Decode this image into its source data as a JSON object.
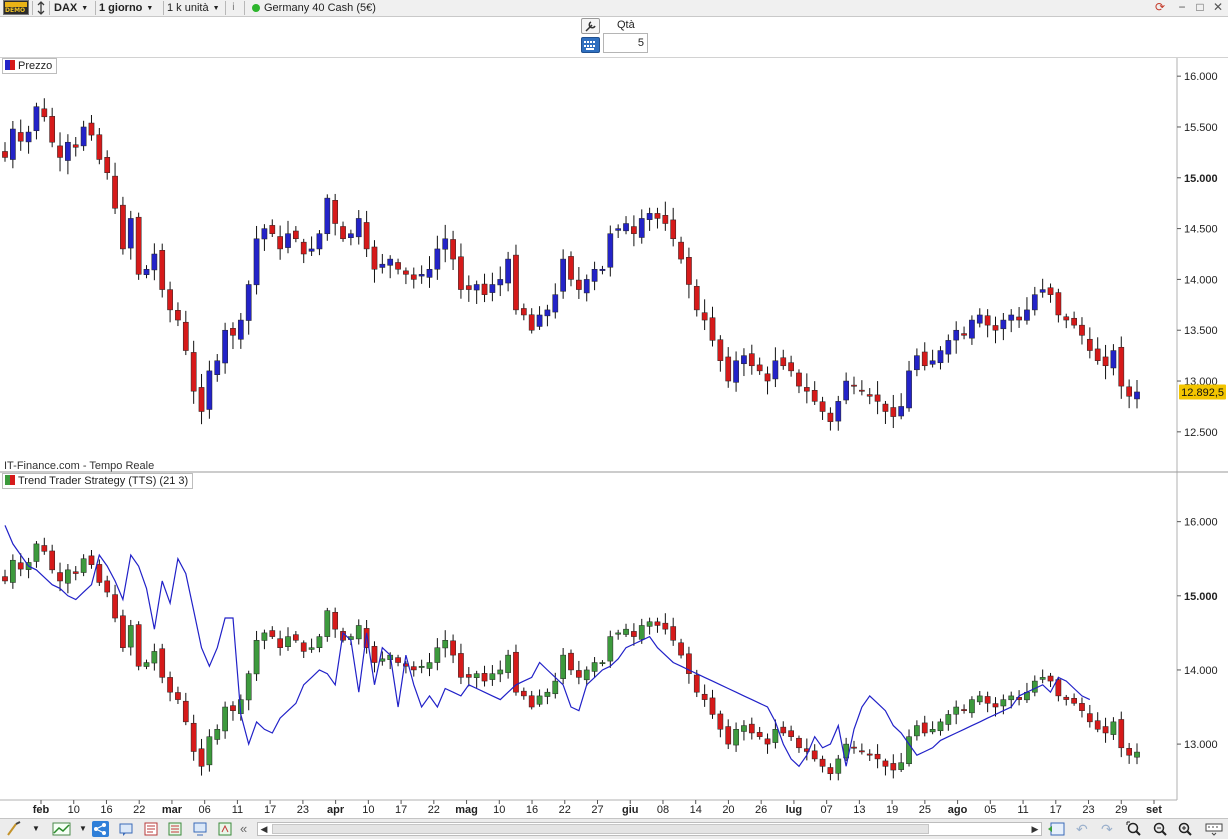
{
  "toolbar": {
    "demo_badge": "DEMO",
    "symbol": "DAX",
    "timeframe": "1 giorno",
    "units": "1 k unità",
    "instrument": "Germany 40 Cash (5€)",
    "status_color": "#2db52d"
  },
  "order_panel": {
    "qty_label": "Qtà",
    "qty_value": "5"
  },
  "price_chart": {
    "label": "Prezzo",
    "watermark": "IT-Finance.com - Tempo Reale",
    "y_ticks": [
      "16.000",
      "15.500",
      "15.000",
      "14.500",
      "14.000",
      "13.500",
      "13.000",
      "12.500"
    ],
    "last_price": "12.892,5",
    "last_price_bg": "#f3c500"
  },
  "indicator_chart": {
    "label": "Trend Trader Strategy (TTS) (21 3)",
    "y_ticks": [
      "16.000",
      "15.000",
      "14.000",
      "13.000"
    ],
    "line_color": "#2121c8"
  },
  "x_axis": {
    "ticks": [
      {
        "label": "feb",
        "bold": true
      },
      {
        "label": "10",
        "bold": false
      },
      {
        "label": "16",
        "bold": false
      },
      {
        "label": "22",
        "bold": false
      },
      {
        "label": "mar",
        "bold": true
      },
      {
        "label": "06",
        "bold": false
      },
      {
        "label": "11",
        "bold": false
      },
      {
        "label": "17",
        "bold": false
      },
      {
        "label": "23",
        "bold": false
      },
      {
        "label": "apr",
        "bold": true
      },
      {
        "label": "10",
        "bold": false
      },
      {
        "label": "17",
        "bold": false
      },
      {
        "label": "22",
        "bold": false
      },
      {
        "label": "mag",
        "bold": true
      },
      {
        "label": "10",
        "bold": false
      },
      {
        "label": "16",
        "bold": false
      },
      {
        "label": "22",
        "bold": false
      },
      {
        "label": "27",
        "bold": false
      },
      {
        "label": "giu",
        "bold": true
      },
      {
        "label": "08",
        "bold": false
      },
      {
        "label": "14",
        "bold": false
      },
      {
        "label": "20",
        "bold": false
      },
      {
        "label": "26",
        "bold": false
      },
      {
        "label": "lug",
        "bold": true
      },
      {
        "label": "07",
        "bold": false
      },
      {
        "label": "13",
        "bold": false
      },
      {
        "label": "19",
        "bold": false
      },
      {
        "label": "25",
        "bold": false
      },
      {
        "label": "ago",
        "bold": true
      },
      {
        "label": "05",
        "bold": false
      },
      {
        "label": "11",
        "bold": false
      },
      {
        "label": "17",
        "bold": false
      },
      {
        "label": "23",
        "bold": false
      },
      {
        "label": "29",
        "bold": false
      },
      {
        "label": "set",
        "bold": true
      }
    ]
  },
  "colors": {
    "bull": "#2323c8",
    "bear": "#d61a1a",
    "tts_bull": "#3d9a3d",
    "tts_bear": "#d61a1a"
  },
  "chart_data": {
    "type": "candlestick",
    "series_close": [
      15200,
      15480,
      15360,
      15450,
      15700,
      15600,
      15350,
      15200,
      15350,
      15300,
      15500,
      15420,
      15180,
      15050,
      14700,
      14300,
      14600,
      14050,
      14100,
      14250,
      13900,
      13700,
      13600,
      13300,
      12900,
      12700,
      13100,
      13200,
      13500,
      13450,
      13600,
      13950,
      14400,
      14500,
      14450,
      14300,
      14450,
      14400,
      14250,
      14300,
      14450,
      14800,
      14550,
      14400,
      14450,
      14600,
      14300,
      14100,
      14150,
      14200,
      14100,
      14050,
      14000,
      14050,
      14100,
      14300,
      14400,
      14200,
      13900,
      13900,
      13950,
      13850,
      13950,
      14000,
      14200,
      13700,
      13650,
      13500,
      13650,
      13700,
      13850,
      14200,
      14000,
      13900,
      14000,
      14100,
      14100,
      14450,
      14500,
      14550,
      14450,
      14600,
      14650,
      14600,
      14550,
      14400,
      14200,
      13950,
      13700,
      13600,
      13400,
      13200,
      13000,
      13200,
      13250,
      13150,
      13100,
      13000,
      13200,
      13150,
      13100,
      12950,
      12900,
      12800,
      12700,
      12600,
      12800,
      13000,
      12950,
      12900,
      12850,
      12800,
      12700,
      12650,
      12750,
      13100,
      13250,
      13150,
      13200,
      13300,
      13400,
      13500,
      13450,
      13600,
      13650,
      13550,
      13500,
      13600,
      13650,
      13600,
      13700,
      13850,
      13900,
      13850,
      13650,
      13600,
      13550,
      13450,
      13300,
      13200,
      13150,
      13300,
      12950,
      12850,
      12892.5
    ],
    "price_ylim": [
      12400,
      16100
    ],
    "tts_values": [
      15950,
      15700,
      15550,
      15400,
      15350,
      15250,
      15150,
      15100,
      15000,
      14950,
      15050,
      15150,
      15550,
      15400,
      15200,
      14950,
      15550,
      15400,
      15100,
      14550,
      15200,
      14900,
      15500,
      15300,
      14800,
      14300,
      14050,
      14300,
      14700,
      14700,
      13400,
      13000,
      13300,
      13200,
      13150,
      13350,
      13450,
      13550,
      13800,
      13900,
      14000,
      13950,
      13800,
      14500,
      14400,
      13700,
      14500,
      13800,
      14300,
      14200,
      13500,
      14200,
      13800,
      13500,
      13650,
      13500,
      13750,
      13700,
      13650,
      13800,
      13750,
      13700,
      13650,
      13600,
      13700,
      13800,
      13850,
      13900,
      14100,
      14000,
      13900,
      13800,
      13500,
      13450,
      13800,
      13900,
      14000,
      14050,
      14150,
      14300,
      14350,
      14400,
      14450,
      14300,
      14200,
      14100,
      14050,
      14000,
      13950,
      13900,
      13850,
      13800,
      13750,
      13700,
      13650,
      13600,
      13550,
      13500,
      13300,
      13000,
      12800,
      12700,
      12850,
      13100,
      12950,
      13000,
      13250,
      12700,
      13200,
      13500,
      13650,
      13550,
      13450,
      13250,
      13150,
      13000,
      12850,
      12900,
      12950,
      13050,
      13100,
      13150,
      13200,
      13250,
      13300,
      13350,
      13400,
      13450,
      13500,
      13650,
      13700,
      13750,
      13800,
      13700,
      13900,
      13850,
      13750,
      13650,
      13600
    ],
    "tts_ylim": [
      12300,
      16400
    ]
  }
}
